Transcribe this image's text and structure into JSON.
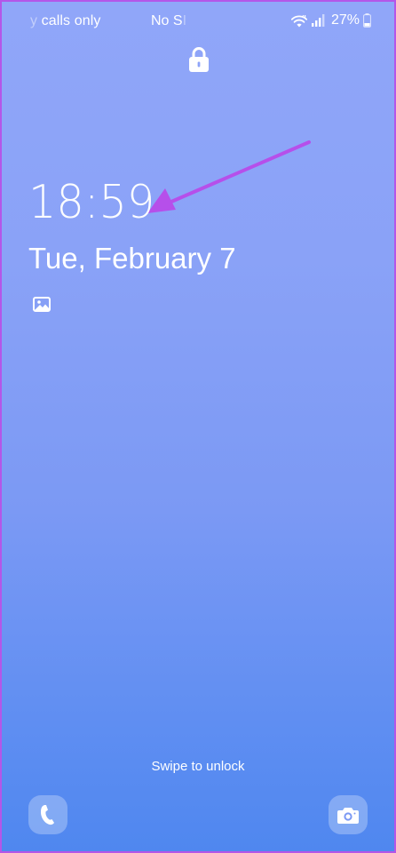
{
  "status_bar": {
    "carrier_faded": "y",
    "carrier_text": " calls only",
    "sim_status": "No S",
    "sim_status_faded": "I",
    "battery_percent": "27%"
  },
  "lock_screen": {
    "time": "18:59",
    "date": "Tue, February 7",
    "swipe_hint": "Swipe to unlock"
  },
  "icons": {
    "lock": "lock-icon",
    "wallpaper": "gallery-icon",
    "phone": "phone-icon",
    "camera": "camera-icon",
    "wifi": "wifi-icon",
    "signal": "signal-icon",
    "battery": "battery-icon"
  },
  "colors": {
    "gradient_top": "#90a6f9",
    "gradient_bottom": "#4f87ef",
    "border": "#b456e8",
    "arrow": "#b64fea"
  }
}
